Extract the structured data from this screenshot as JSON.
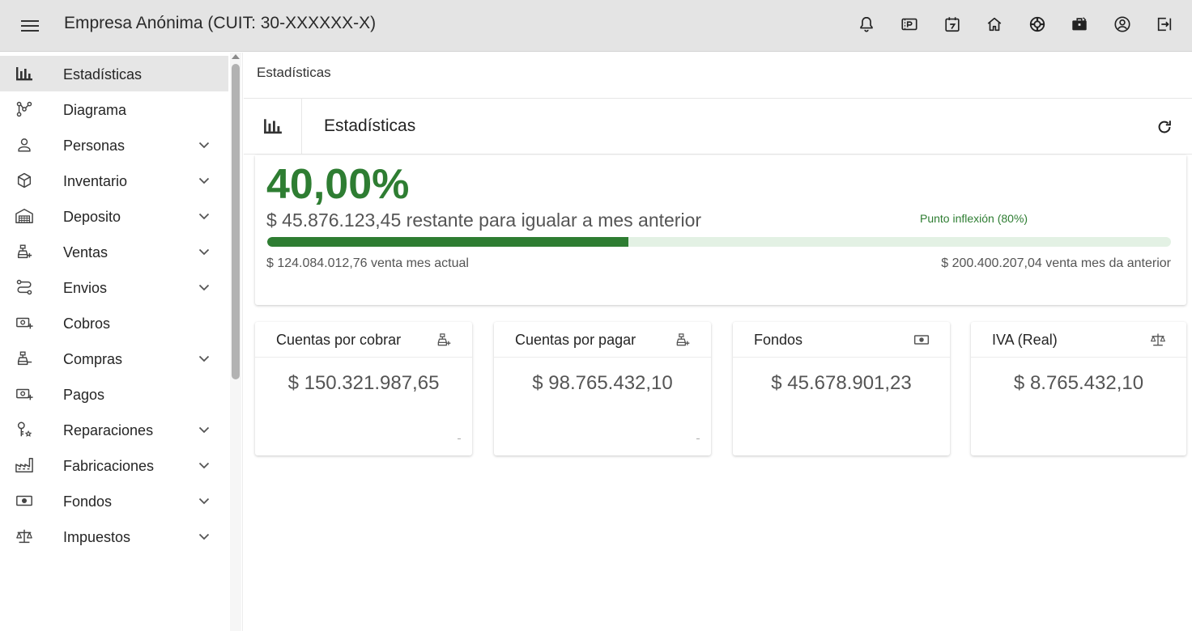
{
  "header": {
    "title": "Empresa Anónima (CUIT: 30-XXXXXX-X)",
    "icons": [
      "bell-icon",
      "ticket-icon",
      "calendar-icon",
      "home-icon",
      "support-icon",
      "briefcase-icon",
      "account-icon",
      "logout-icon"
    ]
  },
  "sidebar": {
    "items": [
      {
        "label": "Estadísticas",
        "icon": "bar-chart-icon",
        "expandable": false,
        "active": true
      },
      {
        "label": "Diagrama",
        "icon": "diagram-icon",
        "expandable": false
      },
      {
        "label": "Personas",
        "icon": "person-icon",
        "expandable": true
      },
      {
        "label": "Inventario",
        "icon": "box-icon",
        "expandable": true
      },
      {
        "label": "Deposito",
        "icon": "warehouse-icon",
        "expandable": true
      },
      {
        "label": "Ventas",
        "icon": "register-icon",
        "expandable": true
      },
      {
        "label": "Envios",
        "icon": "route-icon",
        "expandable": true
      },
      {
        "label": "Cobros",
        "icon": "cash-in-icon",
        "expandable": false
      },
      {
        "label": "Compras",
        "icon": "register-out-icon",
        "expandable": true
      },
      {
        "label": "Pagos",
        "icon": "cash-out-icon",
        "expandable": false
      },
      {
        "label": "Reparaciones",
        "icon": "repair-icon",
        "expandable": true
      },
      {
        "label": "Fabricaciones",
        "icon": "factory-icon",
        "expandable": true
      },
      {
        "label": "Fondos",
        "icon": "money-icon",
        "expandable": true
      },
      {
        "label": "Impuestos",
        "icon": "scale-icon",
        "expandable": true
      }
    ]
  },
  "breadcrumb": "Estadísticas",
  "panel": {
    "title": "Estadísticas"
  },
  "stats": {
    "percent": "40,00%",
    "progress": 0.4,
    "remaining_text": "$ 45.876.123,45 restante para igualar a mes anterior",
    "inflexion_label": "Punto inflexión (80%)",
    "current_sale": "$ 124.084.012,76 venta mes actual",
    "previous_sale": "$ 200.400.207,04 venta mes da anterior"
  },
  "kpis": [
    {
      "title": "Cuentas por cobrar",
      "value": "$ 150.321.987,65",
      "icon": "register-icon"
    },
    {
      "title": "Cuentas por pagar",
      "value": "$ 98.765.432,10",
      "icon": "register-icon"
    },
    {
      "title": "Fondos",
      "value": "$ 45.678.901,23",
      "icon": "money-icon"
    },
    {
      "title": "IVA (Real)",
      "value": "$ 8.765.432,10",
      "icon": "scale-icon"
    }
  ],
  "colors": {
    "accent_green": "#2e7d32",
    "progress_track": "#e3f1e4",
    "topbar_bg": "#e4e4e4",
    "active_item_bg": "#e6e6e6"
  }
}
